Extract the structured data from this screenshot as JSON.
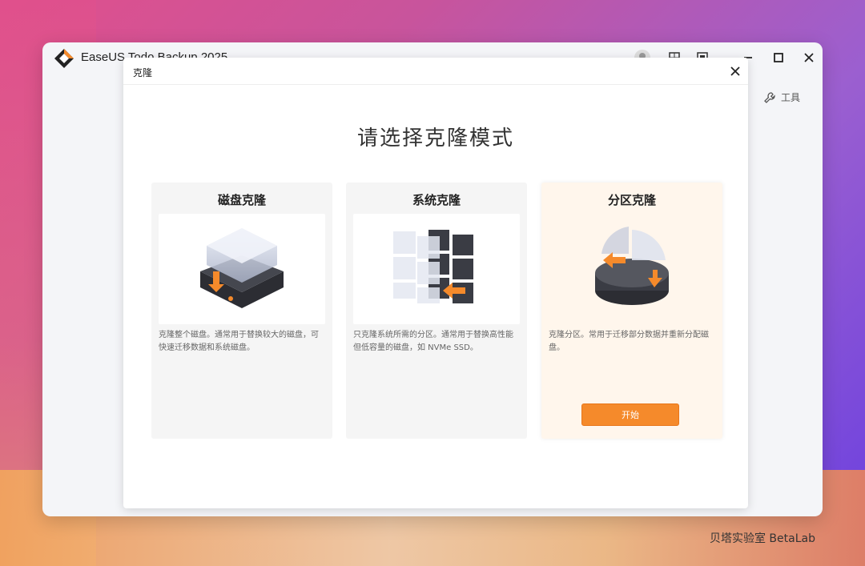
{
  "window": {
    "app_title": "EaseUS Todo Backup 2025",
    "tools_label": "工具"
  },
  "dialog": {
    "title": "克隆",
    "heading": "请选择克隆模式",
    "cards": [
      {
        "title": "磁盘克隆",
        "description": "克隆整个磁盘。通常用于替换较大的磁盘，可快速迁移数据和系统磁盘。"
      },
      {
        "title": "系统克隆",
        "description": "只克隆系统所需的分区。通常用于替换高性能但低容量的磁盘，如 NVMe SSD。"
      },
      {
        "title": "分区克隆",
        "description": "克隆分区。常用于迁移部分数据并重新分配磁盘。",
        "button_label": "开始"
      }
    ]
  },
  "watermark": "贝塔实验室 BetaLab",
  "colors": {
    "accent": "#f58a2b",
    "active_card_bg": "#fff6ec"
  }
}
